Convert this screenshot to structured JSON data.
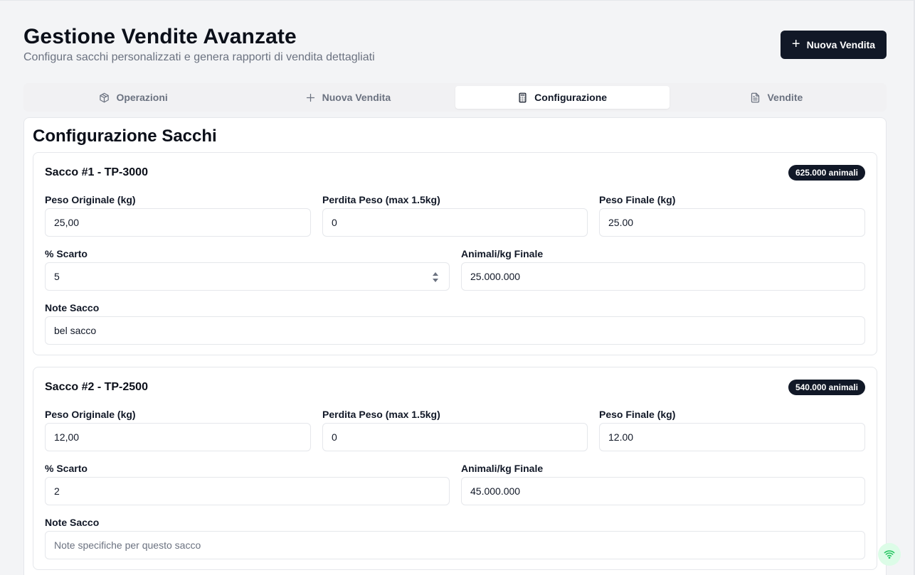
{
  "header": {
    "title": "Gestione Vendite Avanzate",
    "subtitle": "Configura sacchi personalizzati e genera rapporti di vendita dettagliati",
    "new_sale_button": "Nuova Vendita"
  },
  "tabs": [
    {
      "label": "Operazioni",
      "icon": "box-icon",
      "active": false
    },
    {
      "label": "Nuova Vendita",
      "icon": "plus-icon",
      "active": false
    },
    {
      "label": "Configurazione",
      "icon": "calculator-icon",
      "active": true
    },
    {
      "label": "Vendite",
      "icon": "file-text-icon",
      "active": false
    }
  ],
  "section_title": "Configurazione Sacchi",
  "sacchi": [
    {
      "title": "Sacco #1 - TP-3000",
      "badge": "625.000 animali",
      "peso_originale_label": "Peso Originale (kg)",
      "peso_originale": "25,00",
      "perdita_label": "Perdita Peso (max 1.5kg)",
      "perdita": "0",
      "peso_finale_label": "Peso Finale (kg)",
      "peso_finale": "25.00",
      "scarto_label": "% Scarto",
      "scarto": "5",
      "animali_label": "Animali/kg Finale",
      "animali": "25.000.000",
      "note_label": "Note Sacco",
      "note": "bel sacco",
      "note_placeholder": ""
    },
    {
      "title": "Sacco #2 - TP-2500",
      "badge": "540.000 animali",
      "peso_originale_label": "Peso Originale (kg)",
      "peso_originale": "12,00",
      "perdita_label": "Perdita Peso (max 1.5kg)",
      "perdita": "0",
      "peso_finale_label": "Peso Finale (kg)",
      "peso_finale": "12.00",
      "scarto_label": "% Scarto",
      "scarto": "2",
      "animali_label": "Animali/kg Finale",
      "animali": "45.000.000",
      "note_label": "Note Sacco",
      "note": "",
      "note_placeholder": "Note specifiche per questo sacco"
    }
  ],
  "colors": {
    "primary": "#111827",
    "background": "#f3f4f6",
    "muted_text": "#6b7280",
    "status_ok": "#22c55e"
  }
}
